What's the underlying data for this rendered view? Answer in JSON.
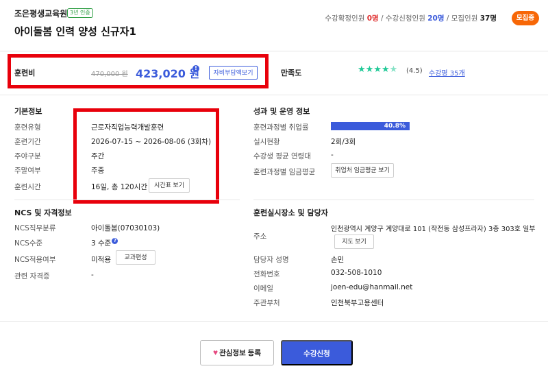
{
  "header": {
    "institution": "조은평생교육원",
    "cert_badge": "3년 인증",
    "course_title": "아이돌봄 인력 양성 신규자1",
    "stats": {
      "confirmed_label": "수강확정인원",
      "confirmed_value": "0명",
      "applied_label": "수강신청인원",
      "applied_value": "20명",
      "capacity_label": "모집인원",
      "capacity_value": "37명",
      "separator": " / "
    },
    "status_badge": "모집중"
  },
  "fee": {
    "label": "훈련비",
    "original": "470,000 원",
    "discounted": "423,020 원",
    "info_icon": "info-icon",
    "self_pay_button": "자비부담액보기"
  },
  "satisfaction": {
    "label": "만족도",
    "rating": 4.5,
    "rating_text": "(4.5)",
    "review_link": "수강평 35개",
    "star_color": "#20c997"
  },
  "basic_info": {
    "title": "기본정보",
    "rows": [
      {
        "label": "훈련유형",
        "value": "근로자직업능력개발훈련"
      },
      {
        "label": "훈련기간",
        "value": "2026-07-15 ~ 2026-08-06 (3회차)"
      },
      {
        "label": "주야구분",
        "value": "주간"
      },
      {
        "label": "주말여부",
        "value": "주중"
      },
      {
        "label": "훈련시간",
        "value": "16일, 총 120시간"
      }
    ],
    "schedule_button": "시간표 보기"
  },
  "performance": {
    "title": "성과 및 운영 정보",
    "rows": [
      {
        "label": "훈련과정별 취업률",
        "value": "40.8%"
      },
      {
        "label": "실시현황",
        "value": "2회/3회"
      },
      {
        "label": "수강생 평균 연령대",
        "value": "-"
      },
      {
        "label": "훈련과정별 임금평균",
        "value": ""
      }
    ],
    "employment_rate": 0.408,
    "wage_button": "취업처 임금평균 보기"
  },
  "ncs": {
    "title": "NCS 및 자격정보",
    "rows": [
      {
        "label": "NCS직무분류",
        "value": "아이돌봄(07030103)"
      },
      {
        "label": "NCS수준",
        "value": "3 수준"
      },
      {
        "label": "NCS적용여부",
        "value": "미적용"
      },
      {
        "label": "관련 자격증",
        "value": "-"
      }
    ],
    "curriculum_button": "교과편성"
  },
  "location": {
    "title": "훈련실시장소 및 담당자",
    "rows": [
      {
        "label": "주소",
        "value": "인천광역시 계양구 계양대로 101 (작전동 삼성프라자) 3층 303호 일부"
      },
      {
        "label": "담당자 성명",
        "value": "손민"
      },
      {
        "label": "전화번호",
        "value": "032-508-1010"
      },
      {
        "label": "이메일",
        "value": "joen-edu@hanmail.net"
      },
      {
        "label": "주관부처",
        "value": "인천북부고용센터"
      }
    ],
    "map_button": "지도 보기"
  },
  "footer": {
    "interest_button": "관심정보 등록",
    "apply_button": "수강신청"
  },
  "colors": {
    "accent": "#3b5bdb",
    "badge": "#f76707",
    "highlight_border": "#e8000b"
  }
}
